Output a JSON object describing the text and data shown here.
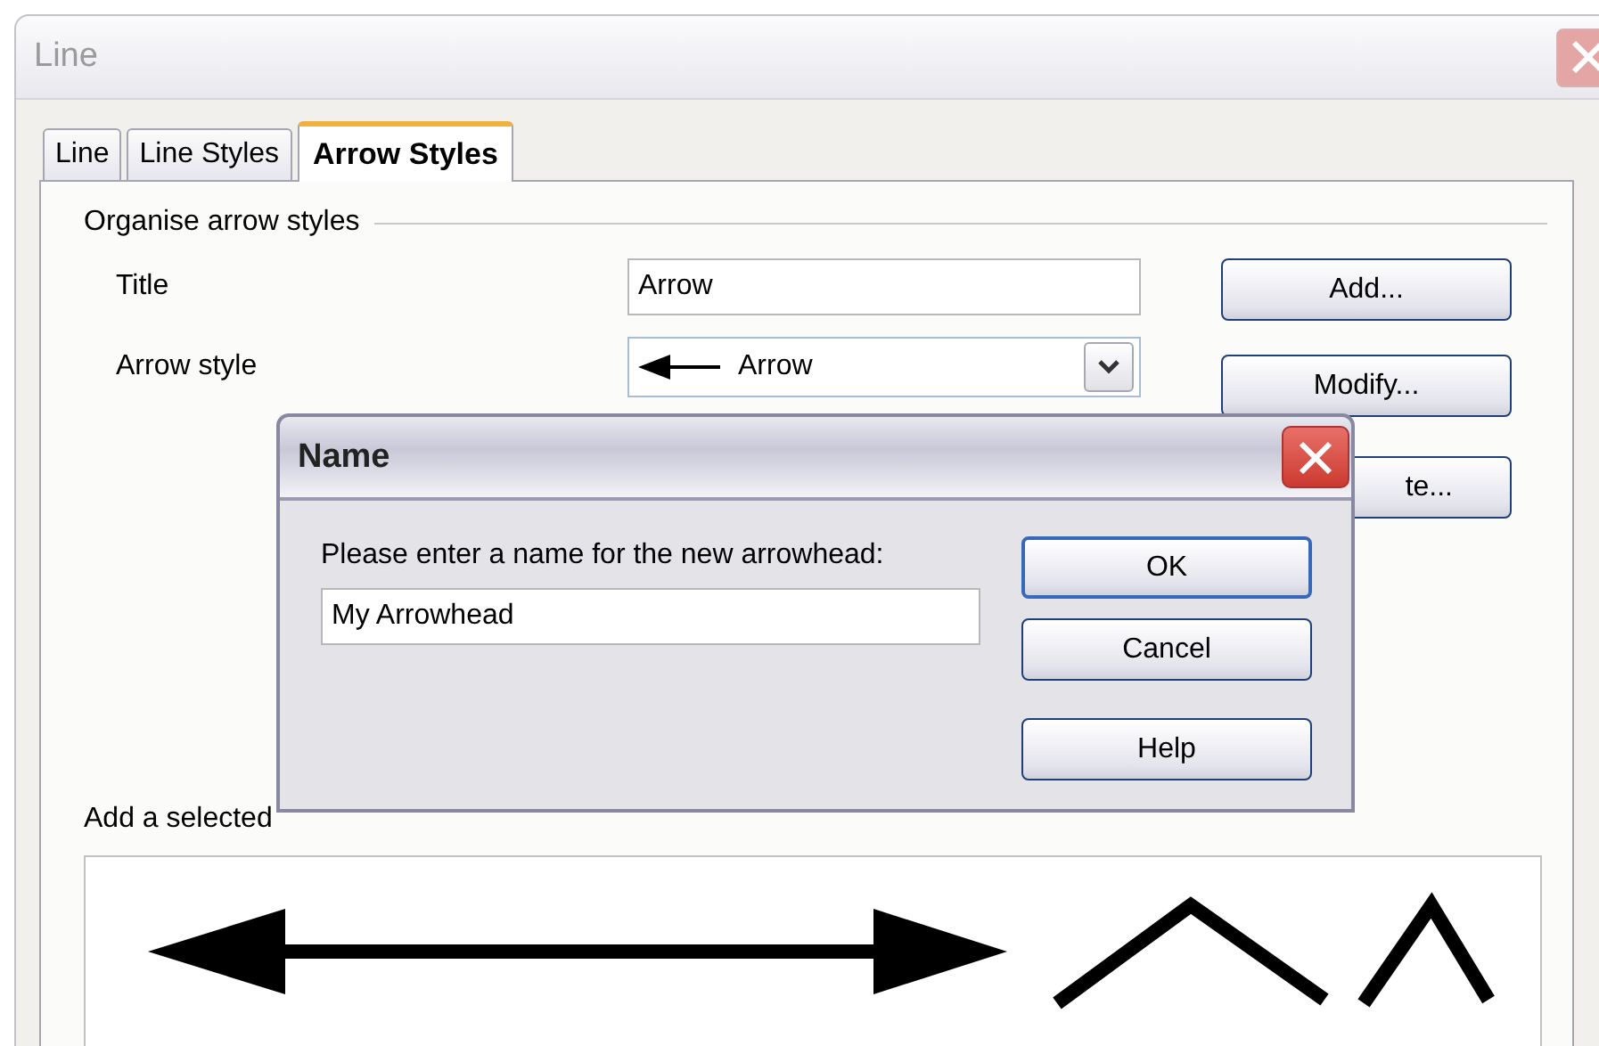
{
  "window": {
    "title": "Line",
    "active": false
  },
  "tabs": [
    {
      "label": "Line",
      "selected": false
    },
    {
      "label": "Line Styles",
      "selected": false
    },
    {
      "label": "Arrow Styles",
      "selected": true
    }
  ],
  "group": {
    "label": "Organise arrow styles",
    "fields": [
      {
        "kind": "text",
        "label": "Title",
        "value": "Arrow"
      },
      {
        "kind": "dropdown",
        "label": "Arrow style",
        "value": "Arrow"
      }
    ],
    "buttons": [
      "Add...",
      "Modify...",
      "te..."
    ]
  },
  "preview": {
    "label": "Add a selected"
  },
  "name_dialog": {
    "title": "Name",
    "prompt": "Please enter a name for the new arrowhead:",
    "value": "My Arrowhead",
    "buttons": [
      {
        "label": "OK",
        "default": true
      },
      {
        "label": "Cancel",
        "default": false
      },
      {
        "label": "Help",
        "default": false
      }
    ]
  }
}
